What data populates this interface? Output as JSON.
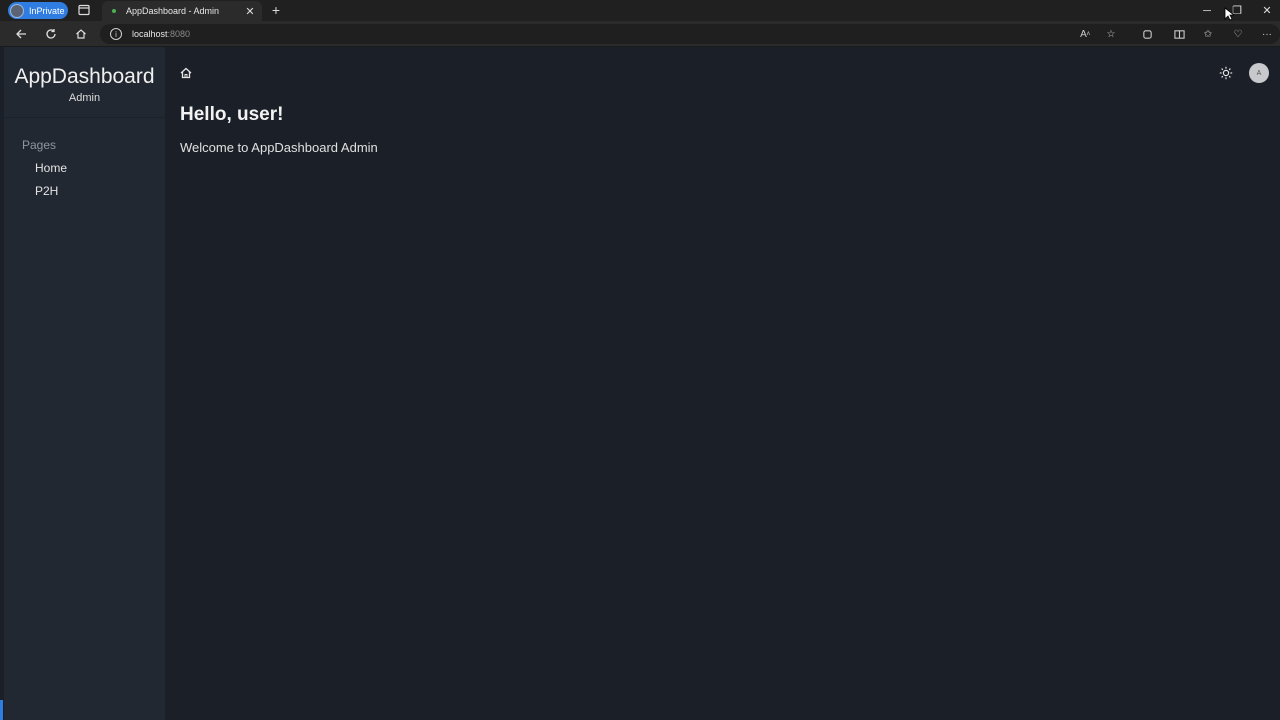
{
  "browser": {
    "inprivate_label": "InPrivate",
    "tab_title": "AppDashboard - Admin",
    "url_host": "localhost",
    "url_port": ":8080"
  },
  "sidebar": {
    "brand": "AppDashboard",
    "brand_sub": "Admin",
    "section_label": "Pages",
    "items": [
      {
        "label": "Home"
      },
      {
        "label": "P2H"
      }
    ]
  },
  "main": {
    "greeting": "Hello, user!",
    "welcome": "Welcome to AppDashboard Admin",
    "avatar_initial": "A"
  },
  "icons": [
    "home-icon",
    "theme-sun-icon",
    "user-avatar",
    "back-icon",
    "refresh-icon",
    "browser-home-icon",
    "info-icon",
    "read-aloud-icon",
    "favorite-icon",
    "extensions-icon",
    "split-screen-icon",
    "favorites-icon",
    "browser-essentials-icon",
    "more-icon"
  ],
  "colors": {
    "sidebar_bg": "#222831",
    "main_bg": "#1b1f27",
    "inprivate_accent": "#2f7de1"
  }
}
